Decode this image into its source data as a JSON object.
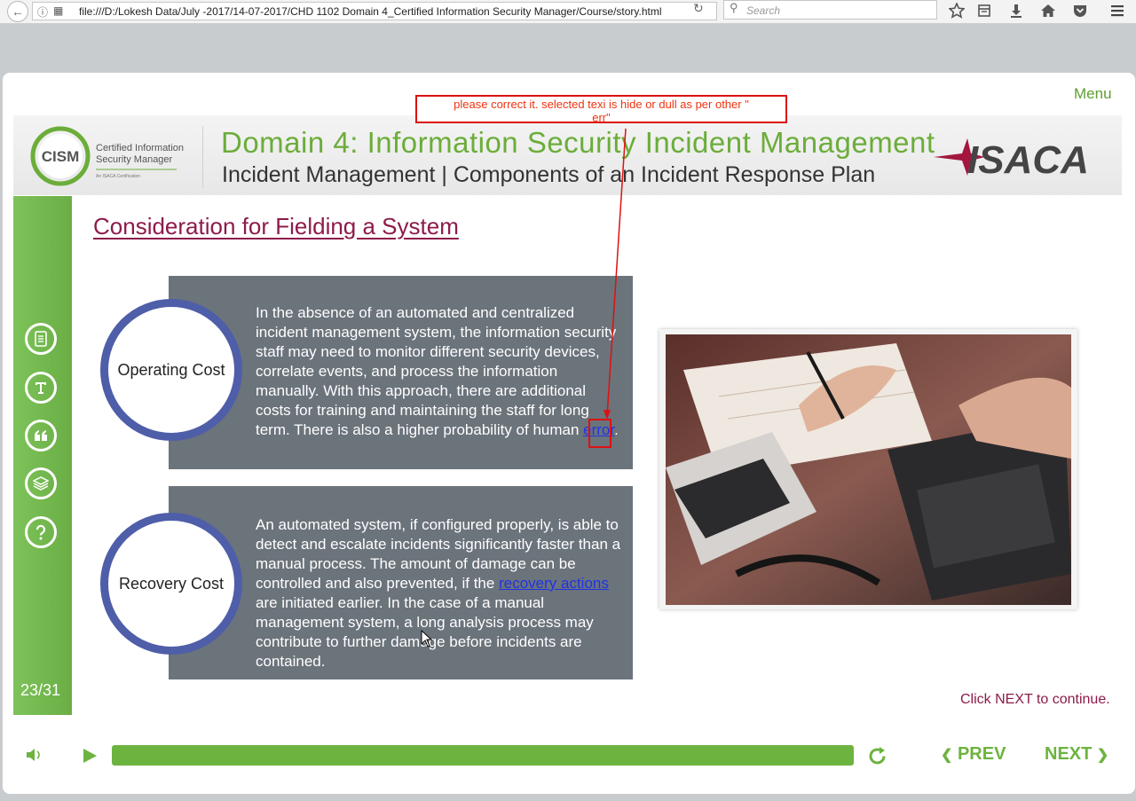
{
  "browser": {
    "url": "file:///D:/Lokesh Data/July -2017/14-07-2017/CHD 1102 Domain 4_Certified Information Security Manager/Course/story.html",
    "search_placeholder": "Search",
    "toolbar_icons": [
      "back-icon",
      "info-icon",
      "page-icon",
      "reload-icon",
      "search-icon",
      "star-icon",
      "reader-icon",
      "download-icon",
      "home-icon",
      "pocket-icon",
      "hamburger-icon"
    ]
  },
  "slide": {
    "menu_label": "Menu",
    "header": {
      "cism_mark": "CISM",
      "cism_line1": "Certified Information",
      "cism_line2": "Security Manager",
      "cism_tagline": "An ISACA Certification",
      "title": "Domain 4: Information Security Incident Management",
      "subtitle": "Incident Management | Components of an Incident Response Plan",
      "isaca_logo": "ISACA"
    },
    "sidebar": {
      "icons": [
        "notes-icon",
        "transcript-icon",
        "quote-icon",
        "resources-icon",
        "help-icon"
      ],
      "page_counter": "23/31"
    },
    "title": "Consideration for Fielding a System",
    "panels": [
      {
        "label": "Operating Cost",
        "text_before": "In the absence of an automated and centralized incident management system, the information security staff may need to monitor different security devices, correlate events, and process the information manually. With this approach, there are additional costs for training and maintaining the staff for long term. There is also a higher probability of human ",
        "link_a": "erro",
        "link_b": "r",
        "text_after": "."
      },
      {
        "label": "Recovery Cost",
        "text_before": "An automated system, if configured properly, is able to detect and escalate incidents significantly faster than a manual process. The amount of damage can be controlled and also prevented, if the ",
        "link": "recovery actions",
        "text_after": " are initiated earlier. In the case of a manual management system, a long analysis process may contribute to further damage before incidents are contained."
      }
    ],
    "continue_text": "Click NEXT to continue.",
    "controls": {
      "prev_label": "PREV",
      "next_label": "NEXT",
      "progress": 1.0
    },
    "annotation": {
      "line1": "please correct it. selected texi is hide or dull as per other \"",
      "line2": "err\""
    },
    "colors": {
      "accent_green": "#6db33f",
      "title_maroon": "#8d1b4b",
      "panel_grey": "#6b737b",
      "ring_blue": "#4f5ea8",
      "link_blue": "#1f33e6",
      "annotation_red": "#dd1111"
    }
  }
}
